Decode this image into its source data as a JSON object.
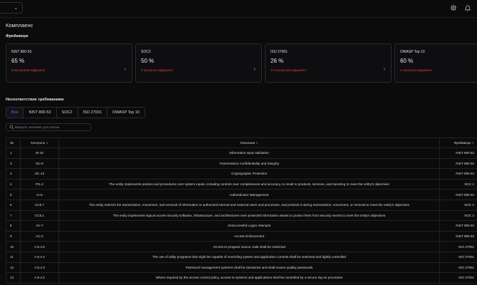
{
  "page_title": "Комплаенс",
  "frameworks_title": "Фреймворк",
  "cards": [
    {
      "name": "NIST 800-53",
      "percent": "65 %",
      "violations": "8 контролей нарушено"
    },
    {
      "name": "SOC2",
      "percent": "50 %",
      "violations": "2 контроля нарушено"
    },
    {
      "name": "ISO 27001",
      "percent": "26 %",
      "violations": "17 контролей нарушено"
    },
    {
      "name": "OWASP Top 10",
      "percent": "60 %",
      "violations": "4 контроля нарушено"
    }
  ],
  "noncompliance_title": "Несоответствие требованиям",
  "tabs": [
    "Все",
    "NIST 800-53",
    "SOC2",
    "ISO 27001",
    "OWASP Top 10"
  ],
  "active_tab": "Все",
  "search": {
    "placeholder": "Введите значение для поиска",
    "value": ""
  },
  "table": {
    "headers": {
      "num": "№",
      "control": "Контроль",
      "description": "Описание",
      "framework": "Фреймворк"
    },
    "rows": [
      {
        "num": "1",
        "control": "SI-10",
        "description": "Information Input Validation",
        "framework": "NIST 800 53"
      },
      {
        "num": "2",
        "control": "SC-8",
        "description": "Transmission Confidentiality and Integrity",
        "framework": "NIST 800 53"
      },
      {
        "num": "3",
        "control": "SC-13",
        "description": "Cryptographic Protection",
        "framework": "NIST 800 53"
      },
      {
        "num": "4",
        "control": "PI1.2",
        "description": "The entity implements policies and procedures over system inputs, including controls over completeness and accuracy, to result in products, services, and reporting to meet the entity's objectives",
        "framework": "SOC 2"
      },
      {
        "num": "5",
        "control": "IA-5",
        "description": "Authenticator Management",
        "framework": "NIST 800 53"
      },
      {
        "num": "6",
        "control": "CC6.7",
        "description": "The entity restricts the transmission, movement, and removal of information to authorized internal and external users and processes, and protects it during transmission, movement, or removal to meet the entity's objectives",
        "framework": "SOC 2"
      },
      {
        "num": "7",
        "control": "CC6.1",
        "description": "The entity implements logical access security software, infrastructure, and architectures over protected information assets to protect them from security events to meet the entity's objectives",
        "framework": "SOC 2"
      },
      {
        "num": "8",
        "control": "AC-7",
        "description": "Unsuccessful Logon Attempts",
        "framework": "NIST 800 53"
      },
      {
        "num": "9",
        "control": "AC-3",
        "description": "Access Enforcement",
        "framework": "NIST 800 53"
      },
      {
        "num": "10",
        "control": "A.9.4.5",
        "description": "Access to program source code shall be restricted",
        "framework": "ISO 27001"
      },
      {
        "num": "11",
        "control": "A.9.4.4",
        "description": "The use of utility programs that might be capable of overriding system and application controls shall be restricted and tightly controlled",
        "framework": "ISO 27001"
      },
      {
        "num": "12",
        "control": "A.9.4.3",
        "description": "Password management systems shall be interactive and shall ensure quality passwords",
        "framework": "ISO 27001"
      },
      {
        "num": "13",
        "control": "A.9.4.2",
        "description": "Where required by the access control policy, access to systems and applications shall be controlled by a secure log-on procedure",
        "framework": "ISO 27001"
      }
    ]
  },
  "colors": {
    "background": "#0b0b0c",
    "accent": "#3b82f6",
    "violation": "#e0443e"
  },
  "icons": {
    "dropdown": "chevron-down-icon",
    "settings": "gear-icon",
    "notifications": "bell-icon",
    "search": "search-icon",
    "card_link": "chevron-right-icon",
    "sort": "sort-icon"
  }
}
